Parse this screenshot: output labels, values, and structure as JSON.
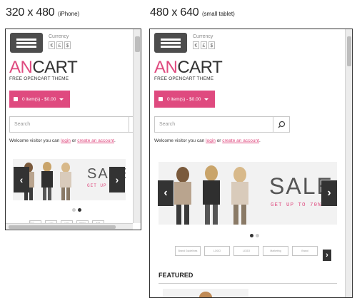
{
  "captions": {
    "left": {
      "dims": "320 x 480",
      "device": "(iPhone)"
    },
    "right": {
      "dims": "480 x 640",
      "device": "(small tablet)"
    }
  },
  "store": {
    "currency_label": "Currency",
    "currencies": [
      "€",
      "£",
      "$"
    ],
    "logo_an": "AN",
    "logo_cart": "CART",
    "logo_sub": "FREE OPENCART THEME",
    "cart_label": "0 item(s) - $0.00",
    "search_placeholder": "Search",
    "welcome_prefix": "Welcome visitor you can",
    "login": "login",
    "or": "or",
    "create_account": "create an account",
    "welcome_suffix": ".",
    "banner_sale": "SALE",
    "banner_sub_small": "GET UP TO",
    "banner_sub_large": "GET UP TO 70%",
    "brands": [
      "Brand Guidelines",
      "LOGO",
      "LOGO",
      "Marketing",
      "Brand"
    ],
    "featured": "FEATURED"
  },
  "icons": {
    "menu": "hamburger-menu-icon",
    "bag": "shopping-bag-icon",
    "search": "magnifier-icon",
    "prev": "chevron-left-icon",
    "next": "chevron-right-icon"
  },
  "colors": {
    "accent": "#df4a7f",
    "menu_bg": "#4d4d4d",
    "arrow_bg": "#333333"
  },
  "slider": {
    "small_active_dot": 2,
    "large_active_dot": 1,
    "dot_count": 2
  }
}
